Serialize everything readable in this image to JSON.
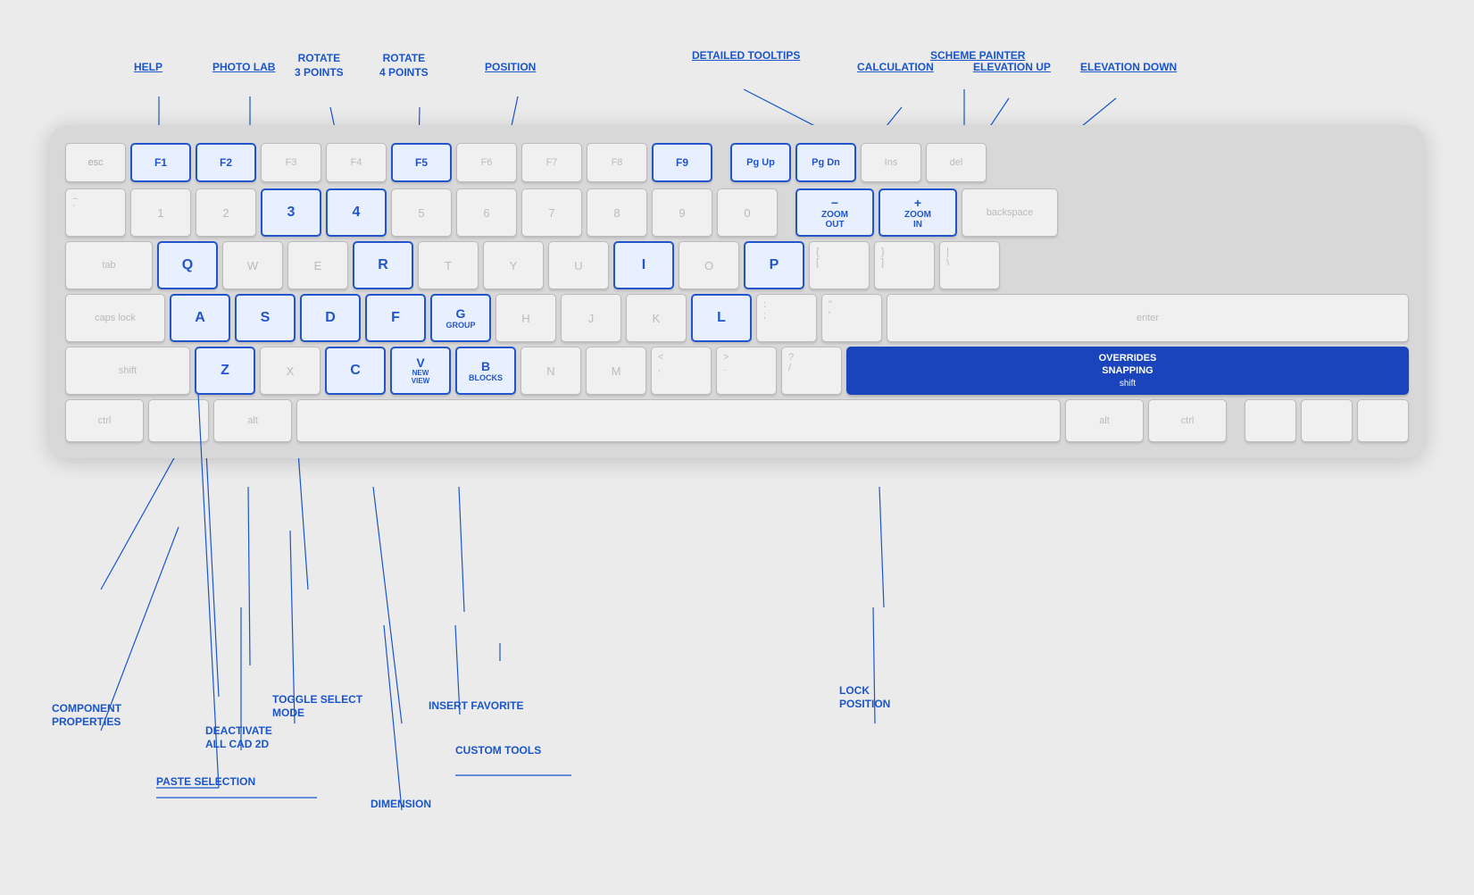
{
  "annotations": {
    "help": "HELP",
    "photo_lab": "PHOTO LAB",
    "rotate_3": "ROTATE\n3 POINTS",
    "rotate_4": "ROTATE\n4 POINTS",
    "position": "POSITION",
    "detailed_tooltips": "DETAILED TOOLTIPS",
    "calculation": "CALCULATION",
    "scheme_painter": "SCHEME PAINTER",
    "elevation_up": "ELEVATION UP",
    "elevation_down": "ELEVATION DOWN",
    "zoom_out": "ZOOM\nOUT",
    "zoom_in": "ZOOM\nIN",
    "group": "GROUP",
    "new_view": "NEW\nVIEW",
    "blocks": "BLOCKS",
    "overrides_snapping": "OVERRIDES\nSNAPPING",
    "overrides_shift": "shift",
    "component_properties": "COMPONENT\nPROPERTIES",
    "paste_selection": "PASTE  SELECTION",
    "deactivate_all": "DEACTIVATE\nALL CAD 2D",
    "toggle_select": "TOGGLE  SELECT\nMODE",
    "dimension": "DIMENSION",
    "insert_favorite": "INSERT  FAVORITE",
    "custom_tools": "CUSTOM TOOLS",
    "lock_position": "LOCK\nPOSITION"
  }
}
